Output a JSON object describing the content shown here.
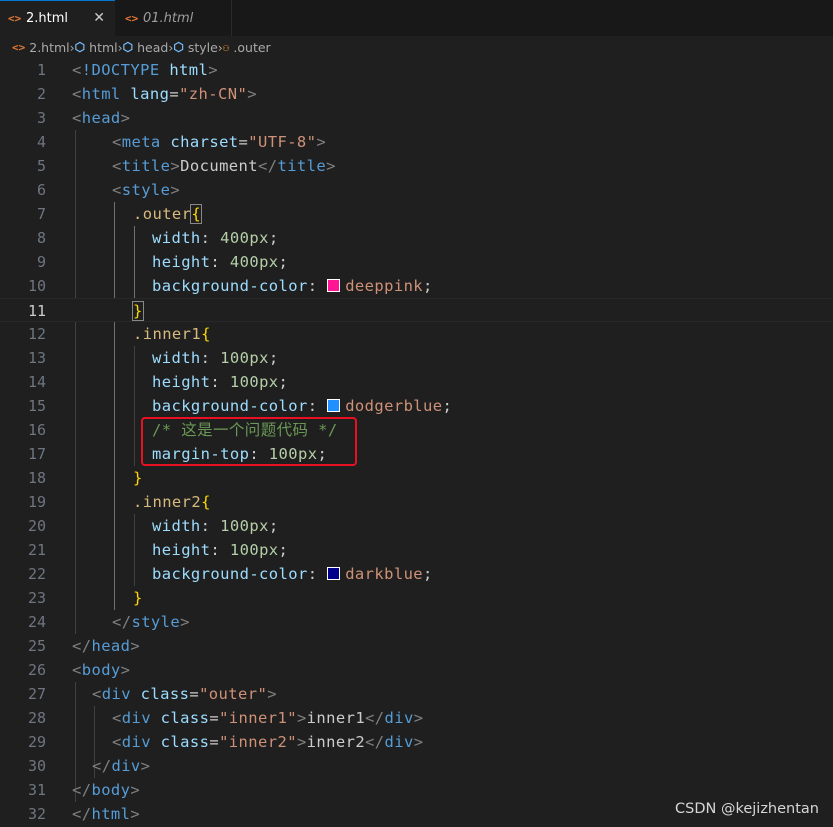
{
  "tabs": [
    {
      "label": "2.html",
      "icon": "html-file-icon",
      "active": true,
      "close": "✕"
    },
    {
      "label": "01.html",
      "icon": "html-file-icon",
      "active": false
    }
  ],
  "breadcrumb": [
    "2.html",
    "html",
    "head",
    "style",
    ".outer"
  ],
  "lines": [
    {
      "n": "1"
    },
    {
      "n": "2"
    },
    {
      "n": "3"
    },
    {
      "n": "4"
    },
    {
      "n": "5"
    },
    {
      "n": "6"
    },
    {
      "n": "7"
    },
    {
      "n": "8"
    },
    {
      "n": "9"
    },
    {
      "n": "10"
    },
    {
      "n": "11"
    },
    {
      "n": "12"
    },
    {
      "n": "13"
    },
    {
      "n": "14"
    },
    {
      "n": "15"
    },
    {
      "n": "16"
    },
    {
      "n": "17"
    },
    {
      "n": "18"
    },
    {
      "n": "19"
    },
    {
      "n": "20"
    },
    {
      "n": "21"
    },
    {
      "n": "22"
    },
    {
      "n": "23"
    },
    {
      "n": "24"
    },
    {
      "n": "25"
    },
    {
      "n": "26"
    },
    {
      "n": "27"
    },
    {
      "n": "28"
    },
    {
      "n": "29"
    },
    {
      "n": "30"
    },
    {
      "n": "31"
    },
    {
      "n": "32"
    }
  ],
  "current_line": "11",
  "code": {
    "l1_doctype": "!DOCTYPE",
    "l1_html": "html",
    "l2_tag": "html",
    "l2_attr": "lang",
    "l2_val": "\"zh-CN\"",
    "l3_tag": "head",
    "l4_tag": "meta",
    "l4_attr": "charset",
    "l4_val": "\"UTF-8\"",
    "l5_tag": "title",
    "l5_text": "Document",
    "l6_tag": "style",
    "l7_sel": ".outer",
    "l8_prop": "width",
    "l8_val": "400px",
    "l9_prop": "height",
    "l9_val": "400px",
    "l10_prop": "background-color",
    "l10_val": "deeppink",
    "l12_sel": ".inner1",
    "l13_prop": "width",
    "l13_val": "100px",
    "l14_prop": "height",
    "l14_val": "100px",
    "l15_prop": "background-color",
    "l15_val": "dodgerblue",
    "l16_comment": "/* 这是一个问题代码 */",
    "l17_prop": "margin-top",
    "l17_val": "100px",
    "l19_sel": ".inner2",
    "l20_prop": "width",
    "l20_val": "100px",
    "l21_prop": "height",
    "l21_val": "100px",
    "l22_prop": "background-color",
    "l22_val": "darkblue",
    "l24_tag": "style",
    "l25_tag": "head",
    "l26_tag": "body",
    "l27_tag": "div",
    "l27_attr": "class",
    "l27_val": "\"outer\"",
    "l28_tag": "div",
    "l28_attr": "class",
    "l28_val": "\"inner1\"",
    "l28_text": "inner1",
    "l29_tag": "div",
    "l29_attr": "class",
    "l29_val": "\"inner2\"",
    "l29_text": "inner2",
    "l30_tag": "div",
    "l31_tag": "body",
    "l32_tag": "html"
  },
  "swatches": {
    "deeppink": "#ff1493",
    "dodgerblue": "#1e90ff",
    "darkblue": "#00008b"
  },
  "annotation": {
    "color": "#e81123"
  },
  "watermark": "CSDN @kejizhentan"
}
